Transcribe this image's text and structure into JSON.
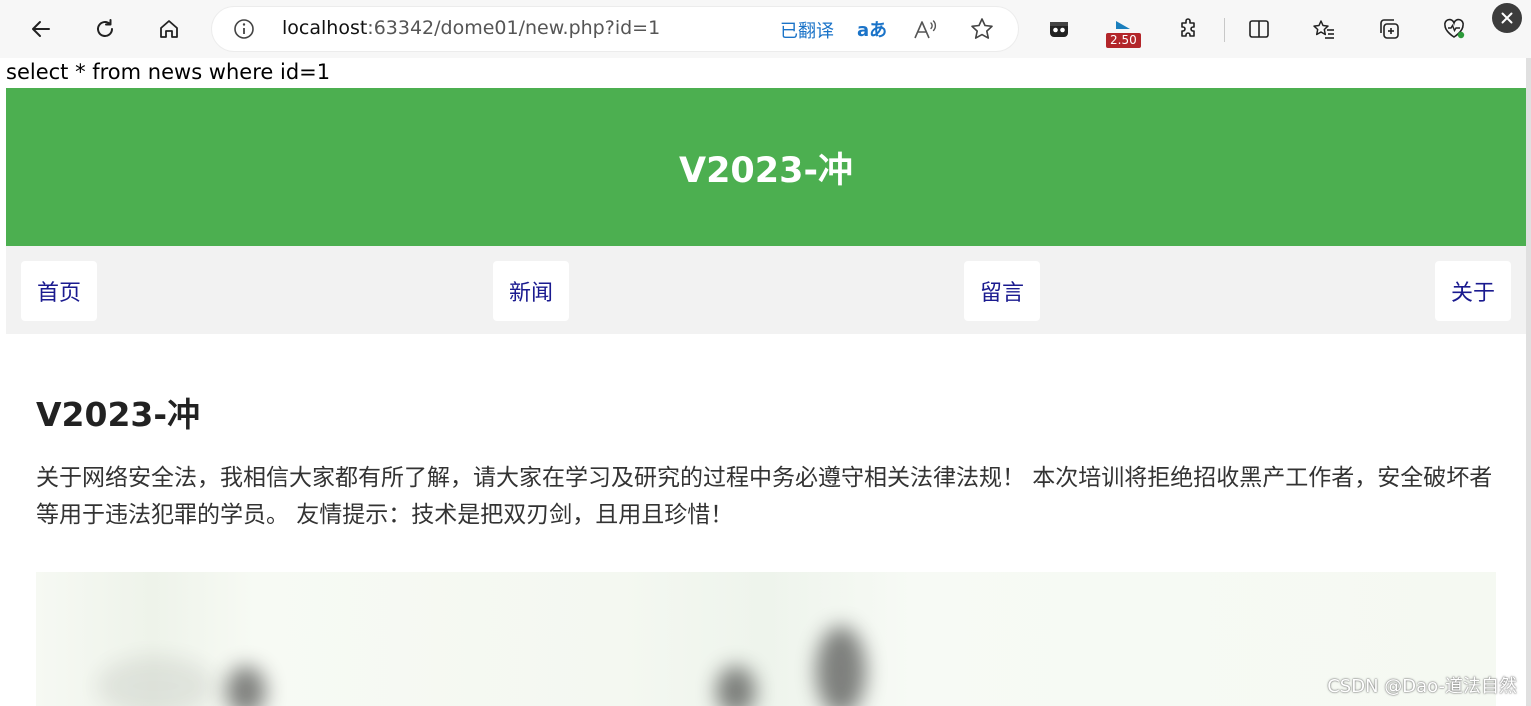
{
  "browser": {
    "url_host": "localhost",
    "url_rest": ":63342/dome01/new.php?id=1",
    "translated_label": "已翻译",
    "translate_icon_text": "aあ",
    "extension_badge": "2.50",
    "icons": [
      "back-icon",
      "refresh-icon",
      "home-icon",
      "info-icon",
      "read-aloud-icon",
      "favorite-star-icon",
      "extension-icon",
      "puzzle-extensions-icon",
      "split-screen-icon",
      "favorites-list-icon",
      "collections-icon",
      "browser-health-icon",
      "close-icon"
    ]
  },
  "page": {
    "sql_debug": "select * from news where id=1",
    "header_title": "V2023-冲",
    "nav": [
      "首页",
      "新闻",
      "留言",
      "关于"
    ],
    "article_title": "V2023-冲",
    "article_body": "关于网络安全法，我相信大家都有所了解，请大家在学习及研究的过程中务必遵守相关法律法规！ 本次培训将拒绝招收黑产工作者，安全破坏者等用于违法犯罪的学员。 友情提示：技术是把双刃剑，且用且珍惜！",
    "watermark": "CSDN @Dao-道法自然"
  },
  "colors": {
    "header_bg": "#4caf50",
    "nav_bg": "#f2f2f2",
    "nav_link": "#1a1a8f",
    "translate_blue": "#1a73c8"
  }
}
